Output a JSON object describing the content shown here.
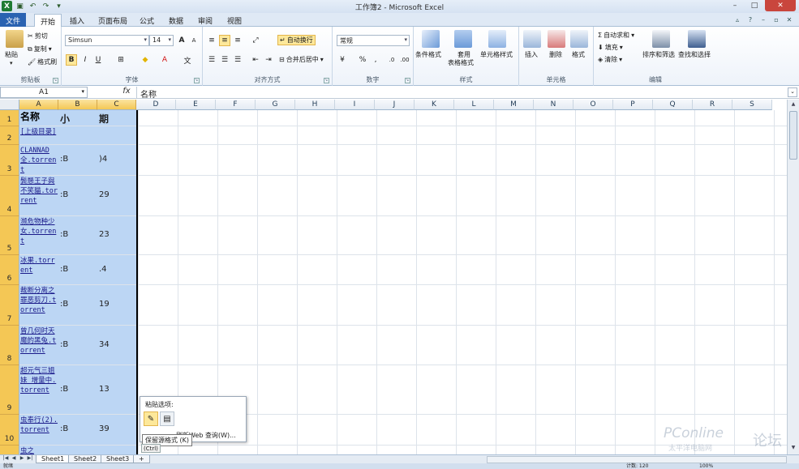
{
  "window": {
    "title": "工作簿2 - Microsoft Excel",
    "minimize": "–",
    "maximize": "□",
    "close": "✕"
  },
  "tabs": [
    {
      "label": "文件"
    },
    {
      "label": "开始"
    },
    {
      "label": "插入"
    },
    {
      "label": "页面布局"
    },
    {
      "label": "公式"
    },
    {
      "label": "数据"
    },
    {
      "label": "审阅"
    },
    {
      "label": "视图"
    }
  ],
  "ribbon": {
    "clipboard": {
      "label": "剪贴板",
      "paste": "粘贴",
      "cut": "剪切",
      "copy": "复制",
      "format_painter": "格式刷"
    },
    "font": {
      "label": "字体",
      "name": "Simsun",
      "size": "14",
      "bold": "B",
      "italic": "I",
      "underline": "U",
      "grow": "A",
      "shrink": "A"
    },
    "alignment": {
      "label": "对齐方式",
      "wrap": "自动换行",
      "merge": "合并后居中"
    },
    "number": {
      "label": "数字",
      "format": "常规",
      "percent": "%",
      "comma": ","
    },
    "styles": {
      "label": "样式",
      "conditional": "条件格式",
      "table": "套用",
      "table2": "表格格式",
      "cell_styles": "单元格样式"
    },
    "cells": {
      "label": "单元格",
      "insert": "插入",
      "delete": "删除",
      "format": "格式"
    },
    "editing": {
      "label": "编辑",
      "autosum": "自动求和",
      "fill": "填充",
      "clear": "清除",
      "sort": "排序和筛选",
      "find": "查找和选择"
    }
  },
  "formula_bar": {
    "name_box": "A1",
    "fx": "fx",
    "content": "名称"
  },
  "columns": [
    "A",
    "B",
    "C",
    "D",
    "E",
    "F",
    "G",
    "H",
    "I",
    "J",
    "K",
    "L",
    "M",
    "N",
    "O",
    "P",
    "Q",
    "R",
    "S"
  ],
  "rows": [
    {
      "num": "1",
      "a": "名称",
      "b": "小",
      "c": "期",
      "header": true
    },
    {
      "num": "2",
      "a": "[上级目录]",
      "b": "",
      "c": ""
    },
    {
      "num": "3",
      "a": "CLANNAD全.torrent",
      "b": ":B",
      "c": ")4"
    },
    {
      "num": "4",
      "a": "鬓懸王子與不笑貓.torrent",
      "b": ":B",
      "c": "29"
    },
    {
      "num": "5",
      "a": "濒危物种少女.torrent",
      "b": ":B",
      "c": "23"
    },
    {
      "num": "6",
      "a": "冰果.torrent",
      "b": ":B",
      "c": ".4"
    },
    {
      "num": "7",
      "a": "裁断分离之罪恶剪刀.torrent",
      "b": ":B",
      "c": "19"
    },
    {
      "num": "8",
      "a": "曾几何时天魔的黑兔.torrent",
      "b": ":B",
      "c": "34"
    },
    {
      "num": "9",
      "a": "超元气三姐妹 增量中.torrent",
      "b": ":B",
      "c": "13"
    },
    {
      "num": "10",
      "a": "虫奉行(2).torrent",
      "b": ":B",
      "c": "39"
    },
    {
      "num": "",
      "a": "虫之",
      "b": "",
      "c": ""
    }
  ],
  "paste_popup": {
    "title": "粘贴选项:",
    "web_query": "刷新Web 查询(W)...",
    "tooltip": "保留源格式 (K)",
    "ctrl": "(Ctrl)"
  },
  "sheets": [
    "Sheet1",
    "Sheet2",
    "Sheet3"
  ],
  "status": {
    "ready": "就绪",
    "count": "计数: 120",
    "zoom": "100%"
  },
  "watermark": {
    "brand": "PConline",
    "sub": "太平洋电脑网",
    "forum": "论坛"
  }
}
